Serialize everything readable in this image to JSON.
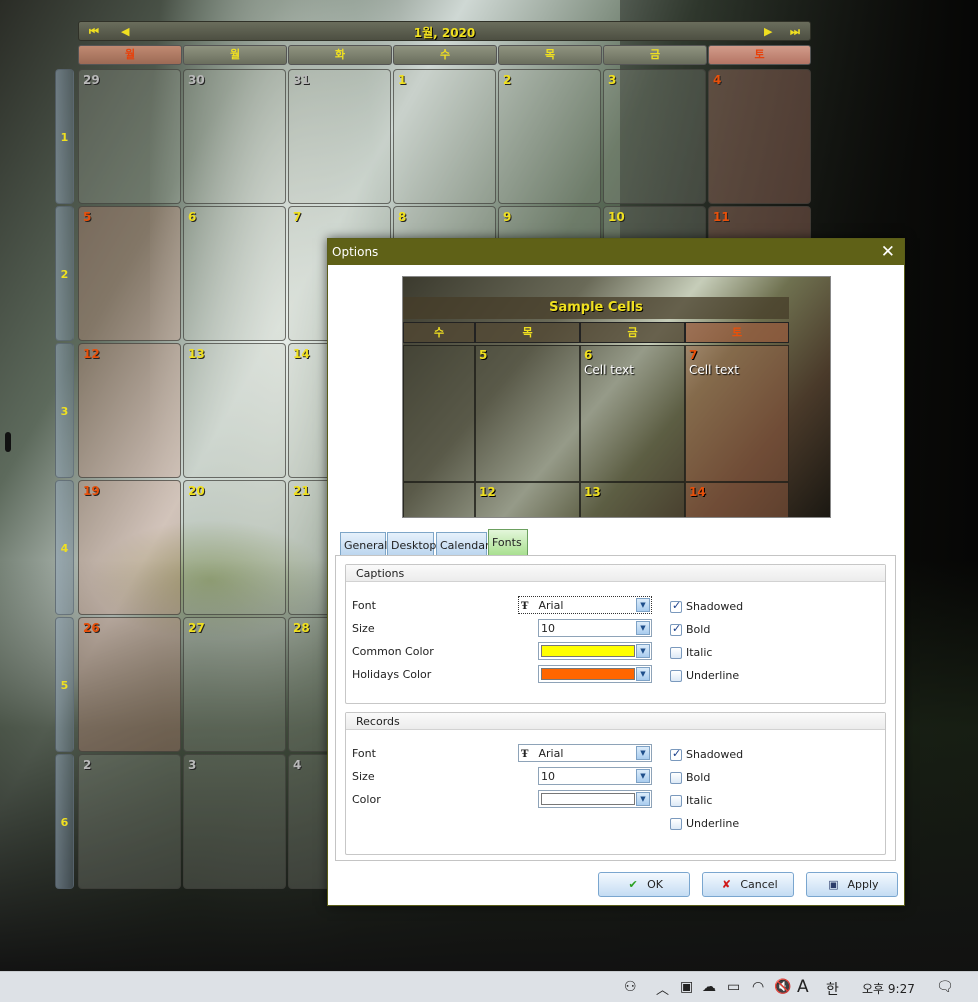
{
  "calendar": {
    "title": "1월, 2020",
    "nav_first": "⏮",
    "nav_prev": "◀",
    "nav_next": "▶",
    "nav_last": "⏭",
    "days": [
      "월",
      "월",
      "화",
      "수",
      "목",
      "금",
      "토"
    ],
    "weeks": [
      "1",
      "2",
      "3",
      "4",
      "5",
      "6"
    ],
    "rows": [
      [
        "29",
        "30",
        "31",
        "1",
        "2",
        "3",
        "4"
      ],
      [
        "5",
        "6",
        "7",
        "8",
        "9",
        "10",
        "11"
      ],
      [
        "12",
        "13",
        "14",
        "",
        "",
        "",
        ""
      ],
      [
        "19",
        "20",
        "21",
        "",
        "",
        "",
        ""
      ],
      [
        "26",
        "27",
        "28",
        "",
        "",
        "",
        ""
      ],
      [
        "2",
        "3",
        "4",
        "",
        "",
        "",
        ""
      ]
    ]
  },
  "dialog": {
    "title": "Options",
    "close": "✕",
    "preview": {
      "title": "Sample Cells",
      "days": [
        "수",
        "목",
        "금",
        "토"
      ],
      "cells_top": [
        "",
        "5",
        "6",
        "7"
      ],
      "cell_text": "Cell text",
      "cells_bottom": [
        "",
        "12",
        "13",
        "14"
      ]
    },
    "tabs": [
      "General",
      "Desktop",
      "Calendar",
      "Fonts"
    ],
    "captions": {
      "header": "Captions",
      "font_label": "Font",
      "font_value": "Arial",
      "size_label": "Size",
      "size_value": "10",
      "common_color_label": "Common Color",
      "holidays_color_label": "Holidays Color",
      "common_color": "#ffff00",
      "holidays_color": "#ff6600",
      "shadowed": "Shadowed",
      "bold": "Bold",
      "italic": "Italic",
      "underline": "Underline"
    },
    "records": {
      "header": "Records",
      "font_label": "Font",
      "font_value": "Arial",
      "size_label": "Size",
      "size_value": "10",
      "color_label": "Color",
      "color": "#ffffff",
      "shadowed": "Shadowed",
      "bold": "Bold",
      "italic": "Italic",
      "underline": "Underline"
    },
    "ok": "OK",
    "cancel": "Cancel",
    "apply": "Apply"
  },
  "taskbar": {
    "ime_a": "A",
    "ime_han": "한",
    "time": "오후 9:27"
  }
}
